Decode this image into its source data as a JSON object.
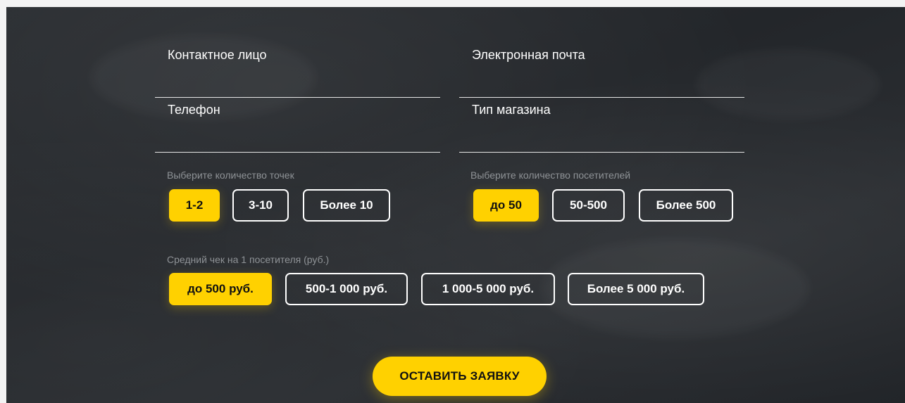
{
  "form": {
    "contact_placeholder": "Контактное лицо",
    "email_placeholder": "Электронная почта",
    "phone_placeholder": "Телефон",
    "shop_type_placeholder": "Тип магазина",
    "points": {
      "label": "Выберите количество точек",
      "options": [
        "1-2",
        "3-10",
        "Более 10"
      ],
      "selected": "1-2"
    },
    "visitors": {
      "label": "Выберите количество посетителей",
      "options": [
        "до 50",
        "50-500",
        "Более 500"
      ],
      "selected": "до 50"
    },
    "avg_check": {
      "label": "Средний чек на 1 посетителя (руб.)",
      "options": [
        "до 500 руб.",
        "500-1 000 руб.",
        "1 000-5 000 руб.",
        "Более 5 000 руб."
      ],
      "selected": "до 500 руб."
    },
    "submit_label": "ОСТАВИТЬ ЗАЯВКУ"
  },
  "colors": {
    "accent": "#ffd100",
    "background": "#26292d",
    "text": "#ffffff",
    "muted_label": "#8f9397"
  }
}
